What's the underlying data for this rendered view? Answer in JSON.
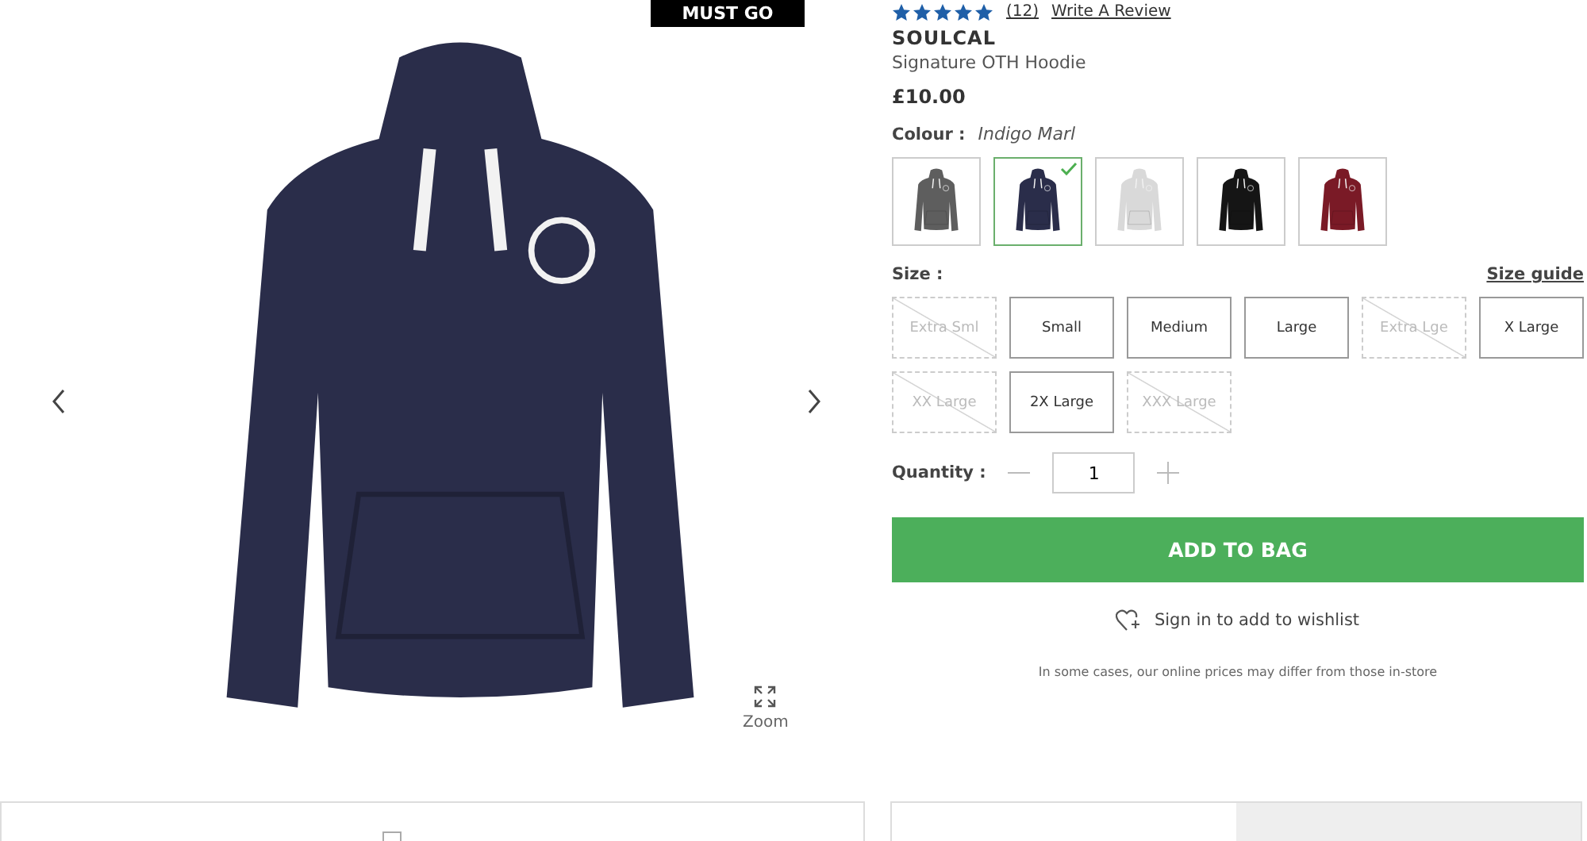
{
  "badge": "MUST GO",
  "zoom": {
    "label": "Zoom"
  },
  "rating": {
    "stars": 5,
    "count": "(12)",
    "review_link": "Write A Review"
  },
  "product": {
    "brand": "SOULCAL",
    "name": "Signature OTH Hoodie",
    "price": "£10.00"
  },
  "colour": {
    "label": "Colour :",
    "value": "Indigo Marl",
    "swatches": [
      {
        "color": "#5e5e5e",
        "selected": false
      },
      {
        "color": "#2a2d4a",
        "selected": true
      },
      {
        "color": "#d9d9d9",
        "selected": false
      },
      {
        "color": "#151515",
        "selected": false
      },
      {
        "color": "#7a1a26",
        "selected": false
      }
    ]
  },
  "size": {
    "label": "Size :",
    "guide": "Size guide",
    "options": [
      {
        "label": "Extra Sml",
        "disabled": true
      },
      {
        "label": "Small",
        "disabled": false
      },
      {
        "label": "Medium",
        "disabled": false
      },
      {
        "label": "Large",
        "disabled": false
      },
      {
        "label": "Extra Lge",
        "disabled": true
      },
      {
        "label": "X Large",
        "disabled": false
      },
      {
        "label": "XX Large",
        "disabled": true
      },
      {
        "label": "2X Large",
        "disabled": false
      },
      {
        "label": "XXX Large",
        "disabled": true
      }
    ]
  },
  "quantity": {
    "label": "Quantity :",
    "value": "1"
  },
  "add_button": "ADD TO BAG",
  "wishlist": "Sign in to add to wishlist",
  "disclaimer": "In some cases, our online prices may differ from those in-store"
}
